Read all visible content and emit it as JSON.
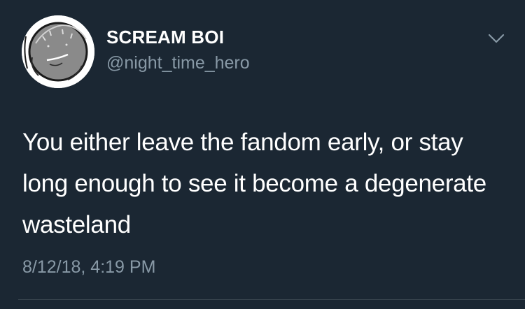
{
  "tweet": {
    "display_name": "SCREAM BOI",
    "handle": "@night_time_hero",
    "text": "You either leave the fandom early, or stay long enough to see it become a degenerate wasteland",
    "timestamp": "8/12/18, 4:19 PM"
  },
  "icons": {
    "menu": "chevron-down-icon",
    "avatar": "sketched-face-avatar"
  },
  "colors": {
    "background": "#1b2733",
    "primary_text": "#ffffff",
    "secondary_text": "#8899a6",
    "divider": "#38444d"
  }
}
